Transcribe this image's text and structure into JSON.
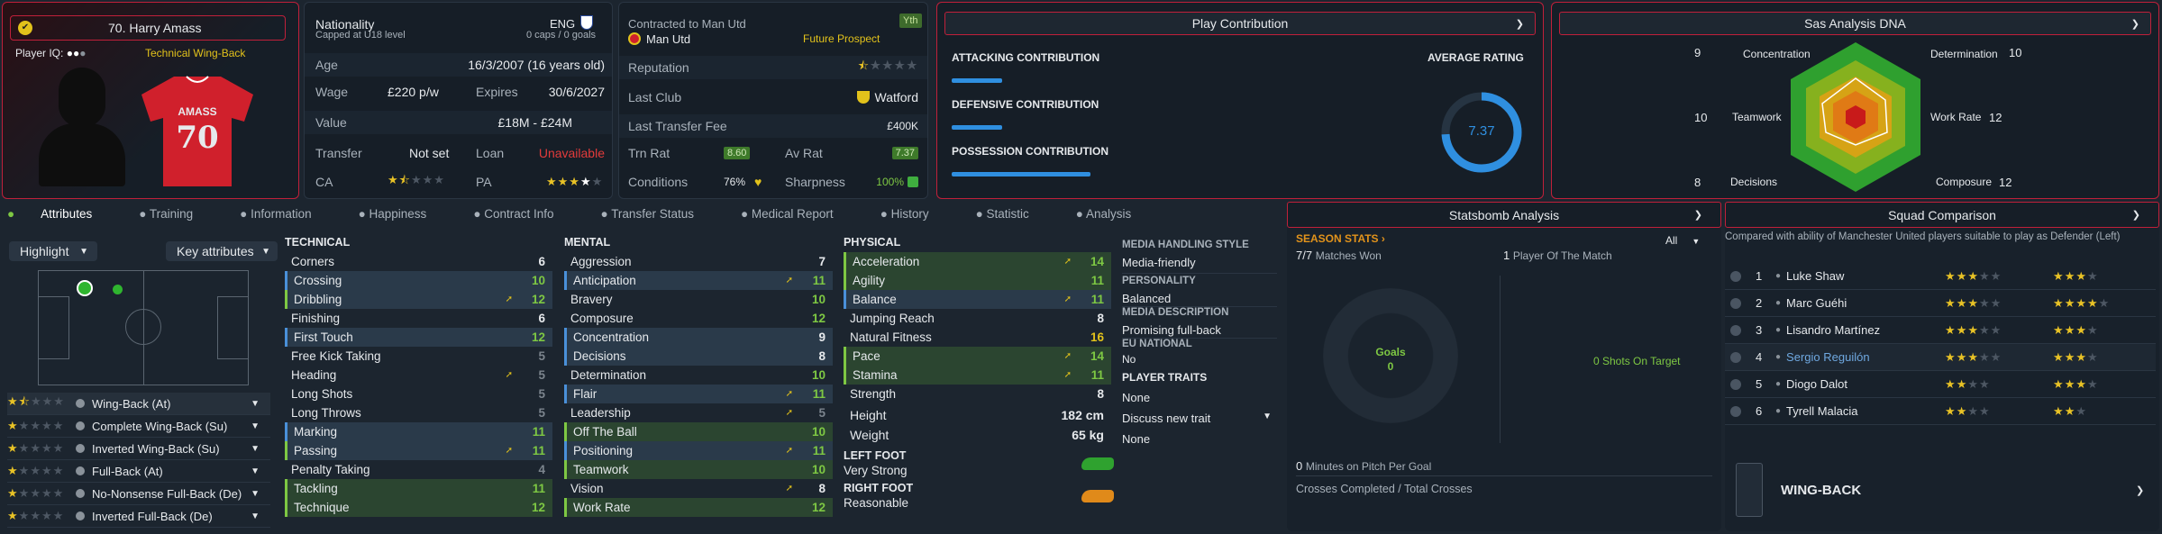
{
  "player": {
    "name": "70. Harry Amass",
    "iq_label": "Player IQ:",
    "role_label": "Technical Wing-Back",
    "shirt_name": "AMASS",
    "shirt_number": "70"
  },
  "info": {
    "nationality_label": "Nationality",
    "nationality_sub": "Capped at U18 level",
    "nation": "ENG",
    "caps": "0 caps / 0 goals",
    "age_label": "Age",
    "age": "16/3/2007 (16 years old)",
    "wage_label": "Wage",
    "wage": "£220 p/w",
    "expires_label": "Expires",
    "expires": "30/6/2027",
    "value_label": "Value",
    "value": "£18M - £24M",
    "transfer_label": "Transfer",
    "transfer": "Not set",
    "loan_label": "Loan",
    "loan": "Unavailable",
    "ca_label": "CA",
    "pa_label": "PA"
  },
  "contract": {
    "contracted": "Contracted to Man Utd",
    "yth": "Yth",
    "club": "Man Utd",
    "prospect": "Future Prospect",
    "reputation_label": "Reputation",
    "last_club_label": "Last Club",
    "last_club": "Watford",
    "fee_label": "Last Transfer Fee",
    "fee": "£400K",
    "trn_label": "Trn Rat",
    "trn": "8.60",
    "av_label": "Av Rat",
    "av": "7.37",
    "cond_label": "Conditions",
    "cond": "76%",
    "sharp_label": "Sharpness",
    "sharp": "100%"
  },
  "play": {
    "title": "Play Contribution",
    "attacking": "ATTACKING CONTRIBUTION",
    "defensive": "DEFENSIVE CONTRIBUTION",
    "possession": "POSSESSION CONTRIBUTION",
    "avg_label": "AVERAGE RATING",
    "avg": "7.37",
    "avg_fraction": 0.74
  },
  "dna": {
    "title": "Sas Analysis DNA",
    "concentration": "Concentration",
    "concentration_v": "9",
    "determination": "Determination",
    "determination_v": "10",
    "teamwork": "Teamwork",
    "teamwork_v": "10",
    "workrate": "Work Rate",
    "workrate_v": "12",
    "decisions": "Decisions",
    "decisions_v": "8",
    "composure": "Composure",
    "composure_v": "12"
  },
  "tabs": [
    "Attributes",
    "Training",
    "Information",
    "Happiness",
    "Contract Info",
    "Transfer Status",
    "Medical Report",
    "History",
    "Statistic",
    "Analysis"
  ],
  "controls": {
    "highlight": "Highlight",
    "key_attributes": "Key attributes"
  },
  "roles": [
    {
      "name": "Wing-Back (At)",
      "stars": 1.5
    },
    {
      "name": "Complete Wing-Back (Su)",
      "stars": 1
    },
    {
      "name": "Inverted Wing-Back (Su)",
      "stars": 1
    },
    {
      "name": "Full-Back (At)",
      "stars": 1
    },
    {
      "name": "No-Nonsense Full-Back (De)",
      "stars": 1
    },
    {
      "name": "Inverted Full-Back (De)",
      "stars": 1
    }
  ],
  "technical": {
    "title": "TECHNICAL",
    "rows": [
      {
        "n": "Corners",
        "v": "6"
      },
      {
        "n": "Crossing",
        "v": "10"
      },
      {
        "n": "Dribbling",
        "v": "12"
      },
      {
        "n": "Finishing",
        "v": "6"
      },
      {
        "n": "First Touch",
        "v": "12"
      },
      {
        "n": "Free Kick Taking",
        "v": "5"
      },
      {
        "n": "Heading",
        "v": "5"
      },
      {
        "n": "Long Shots",
        "v": "5"
      },
      {
        "n": "Long Throws",
        "v": "5"
      },
      {
        "n": "Marking",
        "v": "11"
      },
      {
        "n": "Passing",
        "v": "11"
      },
      {
        "n": "Penalty Taking",
        "v": "4"
      },
      {
        "n": "Tackling",
        "v": "11"
      },
      {
        "n": "Technique",
        "v": "12"
      }
    ]
  },
  "mental": {
    "title": "MENTAL",
    "rows": [
      {
        "n": "Aggression",
        "v": "7"
      },
      {
        "n": "Anticipation",
        "v": "11"
      },
      {
        "n": "Bravery",
        "v": "10"
      },
      {
        "n": "Composure",
        "v": "12"
      },
      {
        "n": "Concentration",
        "v": "9"
      },
      {
        "n": "Decisions",
        "v": "8"
      },
      {
        "n": "Determination",
        "v": "10"
      },
      {
        "n": "Flair",
        "v": "11"
      },
      {
        "n": "Leadership",
        "v": "5"
      },
      {
        "n": "Off The Ball",
        "v": "10"
      },
      {
        "n": "Positioning",
        "v": "11"
      },
      {
        "n": "Teamwork",
        "v": "10"
      },
      {
        "n": "Vision",
        "v": "8"
      },
      {
        "n": "Work Rate",
        "v": "12"
      }
    ]
  },
  "physical": {
    "title": "PHYSICAL",
    "rows": [
      {
        "n": "Acceleration",
        "v": "14"
      },
      {
        "n": "Agility",
        "v": "11"
      },
      {
        "n": "Balance",
        "v": "11"
      },
      {
        "n": "Jumping Reach",
        "v": "8"
      },
      {
        "n": "Natural Fitness",
        "v": "16"
      },
      {
        "n": "Pace",
        "v": "14"
      },
      {
        "n": "Stamina",
        "v": "11"
      },
      {
        "n": "Strength",
        "v": "8"
      }
    ],
    "height_label": "Height",
    "height": "182 cm",
    "weight_label": "Weight",
    "weight": "65 kg",
    "left_foot_label": "LEFT FOOT",
    "left_foot": "Very Strong",
    "right_foot_label": "RIGHT FOOT",
    "right_foot": "Reasonable"
  },
  "media": {
    "handling_label": "MEDIA HANDLING STYLE",
    "handling": "Media-friendly",
    "personality_label": "PERSONALITY",
    "personality": "Balanced",
    "description_label": "MEDIA DESCRIPTION",
    "description": "Promising full-back",
    "eu_label": "EU NATIONAL",
    "eu": "No",
    "traits_label": "PLAYER TRAITS",
    "traits": "None",
    "discuss": "Discuss new trait",
    "traits2": "None"
  },
  "statsbomb": {
    "title": "Statsbomb Analysis",
    "season": "SEASON STATS",
    "filter": "All",
    "won_v": "7/7",
    "won": "Matches Won",
    "potm_v": "1",
    "potm": "Player Of The Match",
    "goals_label": "Goals",
    "goals": "0",
    "shots": "0 Shots On Target",
    "minutes": "0",
    "minutes_label": "Minutes on Pitch Per Goal",
    "crosses": "Crosses Completed / Total Crosses"
  },
  "squad": {
    "title": "Squad Comparison",
    "desc": "Compared with ability of Manchester United players suitable to play as Defender (Left)",
    "rows": [
      {
        "rank": "1",
        "name": "Luke Shaw",
        "ca": "★★★",
        "pa": "★★★"
      },
      {
        "rank": "2",
        "name": "Marc Guéhi",
        "ca": "★★★",
        "pa": "★★★★"
      },
      {
        "rank": "3",
        "name": "Lisandro Martínez",
        "ca": "★★★",
        "pa": "★★★"
      },
      {
        "rank": "4",
        "name": "Sergio Reguilón",
        "ca": "★★★",
        "pa": "★★★"
      },
      {
        "rank": "5",
        "name": "Diogo Dalot",
        "ca": "★★",
        "pa": "★★★"
      },
      {
        "rank": "6",
        "name": "Tyrell Malacia",
        "ca": "★★",
        "pa": "★★"
      }
    ],
    "position": "WING-BACK"
  }
}
